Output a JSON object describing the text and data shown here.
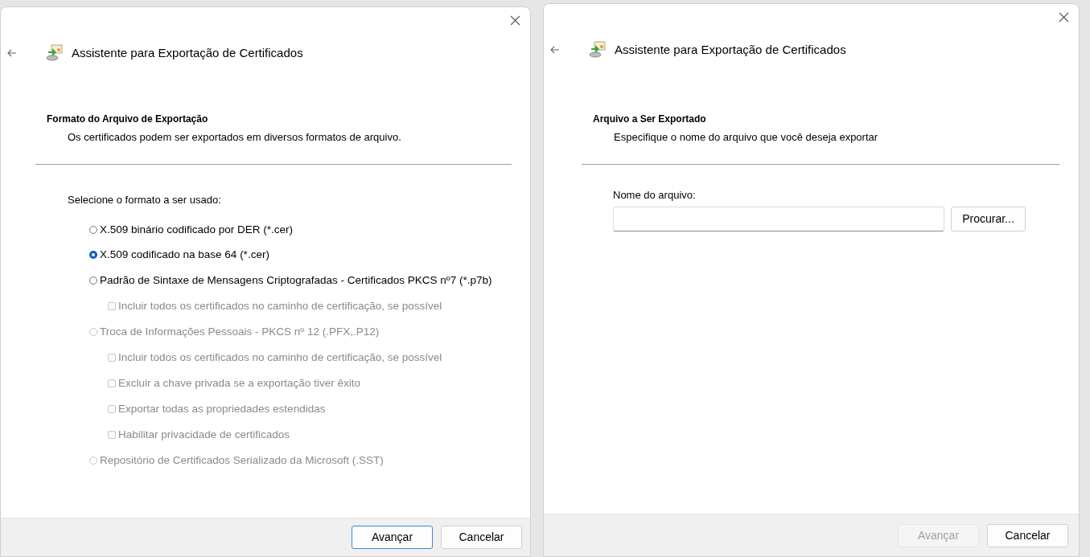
{
  "dialogs": [
    {
      "kind": "format",
      "title": "Assistente para Exportação de Certificados",
      "heading": "Formato do Arquivo de Exportação",
      "subheading": "Os certificados podem ser exportados em diversos formatos de arquivo.",
      "prompt": "Selecione o formato a ser usado:",
      "options": [
        {
          "label": "X.509 binário codificado por DER (*.cer)",
          "selected": false,
          "disabled": false
        },
        {
          "label": "X.509 codificado na base 64 (*.cer)",
          "selected": true,
          "disabled": false
        },
        {
          "label": "Padrão de Sintaxe de Mensagens Criptografadas - Certificados PKCS nº7 (*.p7b)",
          "selected": false,
          "disabled": false,
          "children": [
            {
              "label": "Incluir todos os certificados no caminho de certificação, se possível",
              "checked": false,
              "disabled": true
            }
          ]
        },
        {
          "label": "Troca de Informações Pessoais - PKCS nº 12 (.PFX,.P12)",
          "selected": false,
          "disabled": true,
          "children": [
            {
              "label": "Incluir todos os certificados no caminho de certificação, se possível",
              "checked": false,
              "disabled": true
            },
            {
              "label": "Excluir a chave privada se a exportação tiver êxito",
              "checked": false,
              "disabled": true
            },
            {
              "label": "Exportar todas as propriedades estendidas",
              "checked": false,
              "disabled": true
            },
            {
              "label": "Habilitar privacidade de certificados",
              "checked": false,
              "disabled": true
            }
          ]
        },
        {
          "label": "Repositório de Certificados Serializado da Microsoft (.SST)",
          "selected": false,
          "disabled": true
        }
      ],
      "buttons": [
        {
          "label": "Avançar",
          "disabled": false,
          "focused": true
        },
        {
          "label": "Cancelar",
          "disabled": false,
          "focused": false
        }
      ]
    },
    {
      "kind": "file",
      "title": "Assistente para Exportação de Certificados",
      "heading": "Arquivo a Ser Exportado",
      "subheading": "Especifique o nome do arquivo que você deseja exportar",
      "field": {
        "label": "Nome do arquivo:",
        "button": "Procurar..."
      },
      "buttons": [
        {
          "label": "Avançar",
          "disabled": true,
          "focused": false
        },
        {
          "label": "Cancelar",
          "disabled": false,
          "focused": false
        }
      ]
    }
  ]
}
